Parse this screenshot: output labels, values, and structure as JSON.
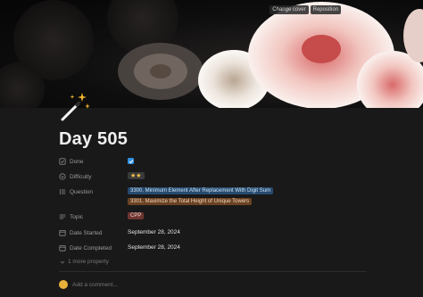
{
  "cover": {
    "change_label": "Change cover",
    "reposition_label": "Reposition"
  },
  "page": {
    "icon": "magic-wand-icon",
    "title": "Day 505"
  },
  "properties": {
    "done": {
      "label": "Done",
      "checked": true
    },
    "difficulty": {
      "label": "Difficulty",
      "value": "★★"
    },
    "question": {
      "label": "Question",
      "values": [
        "3300. Minimum Element After Replacement With Digit Sum",
        "3301. Maximize the Total Height of Unique Towers"
      ]
    },
    "topic": {
      "label": "Topic",
      "value": "CPP"
    },
    "date_started": {
      "label": "Date Started",
      "value": "September 28, 2024"
    },
    "date_completed": {
      "label": "Date Completed",
      "value": "September 28, 2024"
    }
  },
  "more_property": "1 more property",
  "comment": {
    "placeholder": "Add a comment..."
  },
  "colors": {
    "accent": "#2f8fe0",
    "avatar": "#e8b13a"
  }
}
